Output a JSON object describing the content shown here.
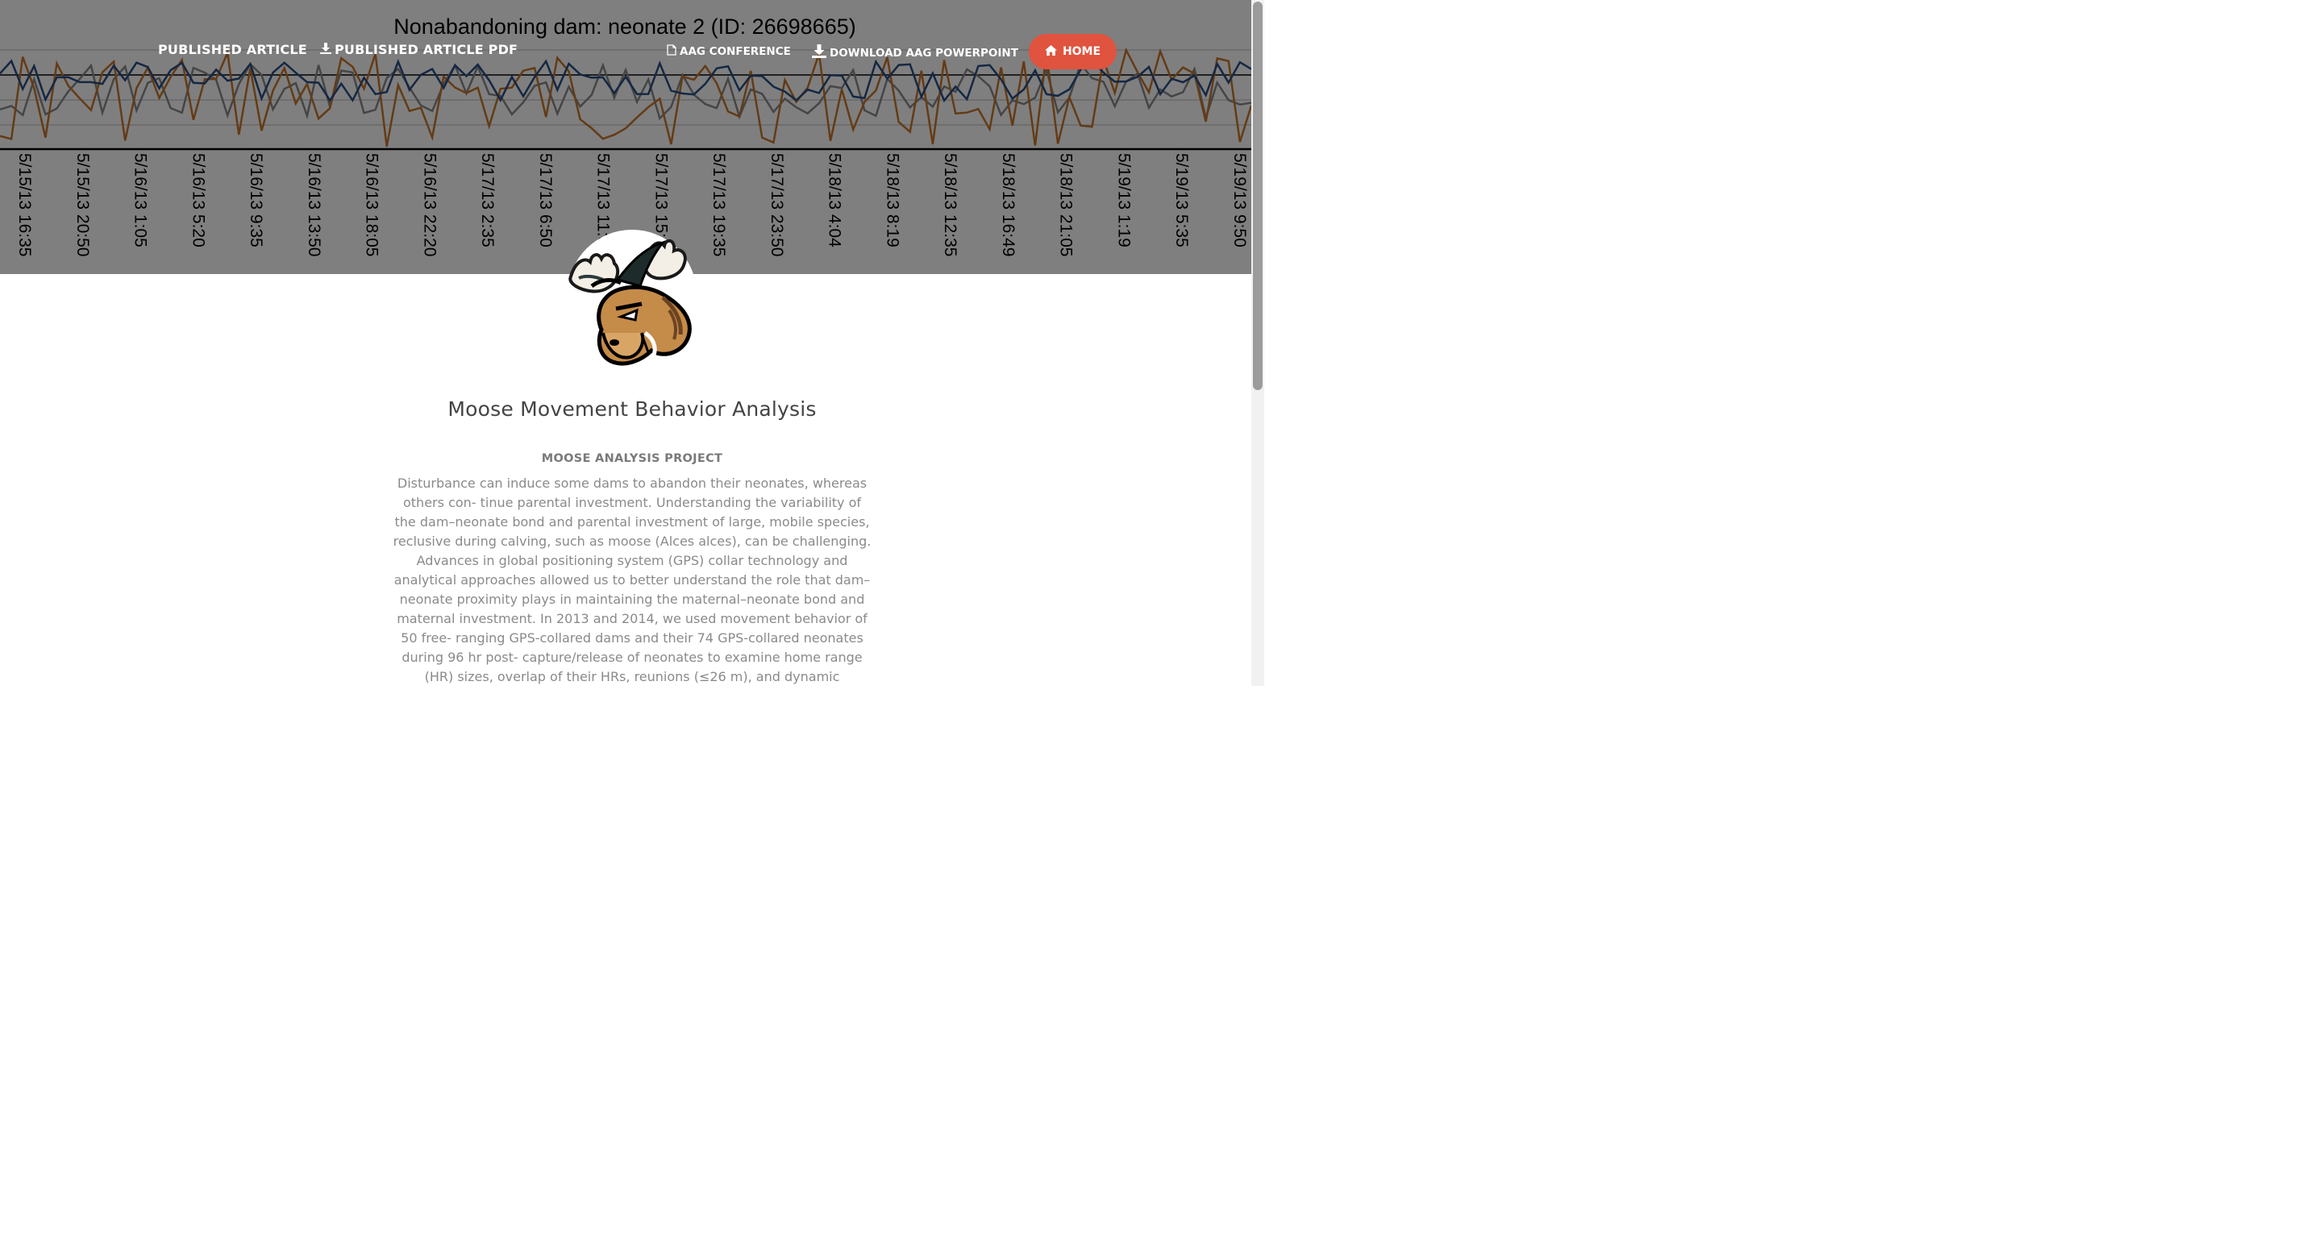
{
  "hero": {
    "chart_title": "Nonabandoning dam: neonate 2 (ID: 26698665)",
    "date_ticks": [
      "5/15/13 16:35",
      "5/15/13 20:50",
      "5/16/13 1:05",
      "5/16/13 5:20",
      "5/16/13 9:35",
      "5/16/13 13:50",
      "5/16/13 18:05",
      "5/16/13 22:20",
      "5/17/13 2:35",
      "5/17/13 6:50",
      "5/17/13 11:05",
      "5/17/13 15:20",
      "5/17/13 19:35",
      "5/17/13 23:50",
      "5/18/13 4:04",
      "5/18/13 8:19",
      "5/18/13 12:35",
      "5/18/13 16:49",
      "5/18/13 21:05",
      "5/19/13 1:19",
      "5/19/13 5:35",
      "5/19/13 9:50"
    ],
    "colors": {
      "overlay": "rgba(0,0,0,0.5)",
      "line_orange": "#c8772a",
      "line_blue": "#2b4f86",
      "line_gray": "#8a8a8a"
    }
  },
  "nav": {
    "published_article": "PUBLISHED ARTICLE",
    "published_article_pdf": "PUBLISHED ARTICLE PDF",
    "aag_conference": "AAG CONFERENCE",
    "download_aag_powerpoint": "DOWNLOAD AAG POWERPOINT",
    "home": "HOME",
    "icons": {
      "pdf": "download-icon",
      "conference": "document-icon",
      "powerpoint": "download-icon",
      "home": "home-icon"
    }
  },
  "logo": {
    "icon": "moose-head-icon"
  },
  "main": {
    "title": "Moose Movement Behavior Analysis",
    "subtitle": "MOOSE ANALYSIS PROJECT",
    "body": "Disturbance can induce some dams to abandon their neonates, whereas others con- tinue parental investment. Understanding the variability of the dam–neonate bond and parental investment of large, mobile species, reclusive during calving, such as moose (Alces alces), can be challenging. Advances in global positioning system (GPS) collar technology and analytical approaches allowed us to better understand the role that dam–neonate proximity plays in maintaining the maternal–neonate bond and maternal investment. In 2013 and 2014, we used movement behavior of 50 free- ranging GPS-collared dams and their 74 GPS-collared neonates during 96 hr post- capture/release of neonates to examine home range (HR) sizes, overlap of their HRs, reunions (≤26 m), and dynamic"
  },
  "colors": {
    "accent": "#e0533e",
    "title": "#444444",
    "subtitle": "#7a7a7a",
    "body": "#8a8a8a"
  }
}
